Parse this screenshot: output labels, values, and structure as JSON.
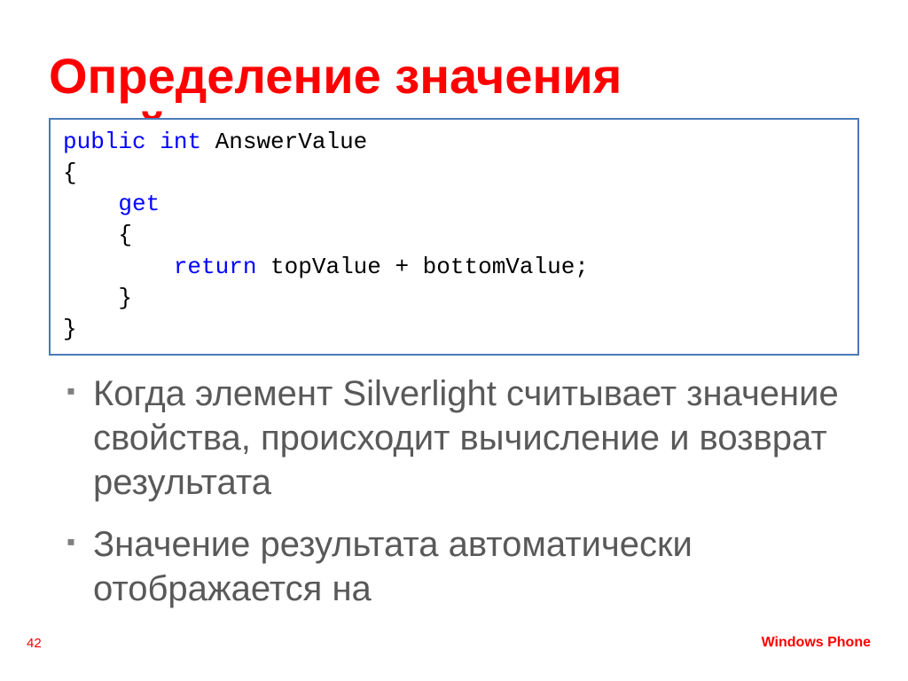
{
  "title": "Определение значения свойства",
  "code": {
    "line1_kw1": "public",
    "line1_kw2": "int",
    "line1_rest": " AnswerValue",
    "line2": "{",
    "line3_kw": "get",
    "line4": "    {",
    "line5_kw": "return",
    "line5_rest": " topValue + bottomValue;",
    "line6": "    }",
    "line7": "}"
  },
  "bullets": [
    "Когда элемент Silverlight считывает значение свойства, происходит вычисление и возврат результата",
    "Значение результата автоматически отображается на"
  ],
  "page_number": "42",
  "footer_brand": "Windows Phone"
}
